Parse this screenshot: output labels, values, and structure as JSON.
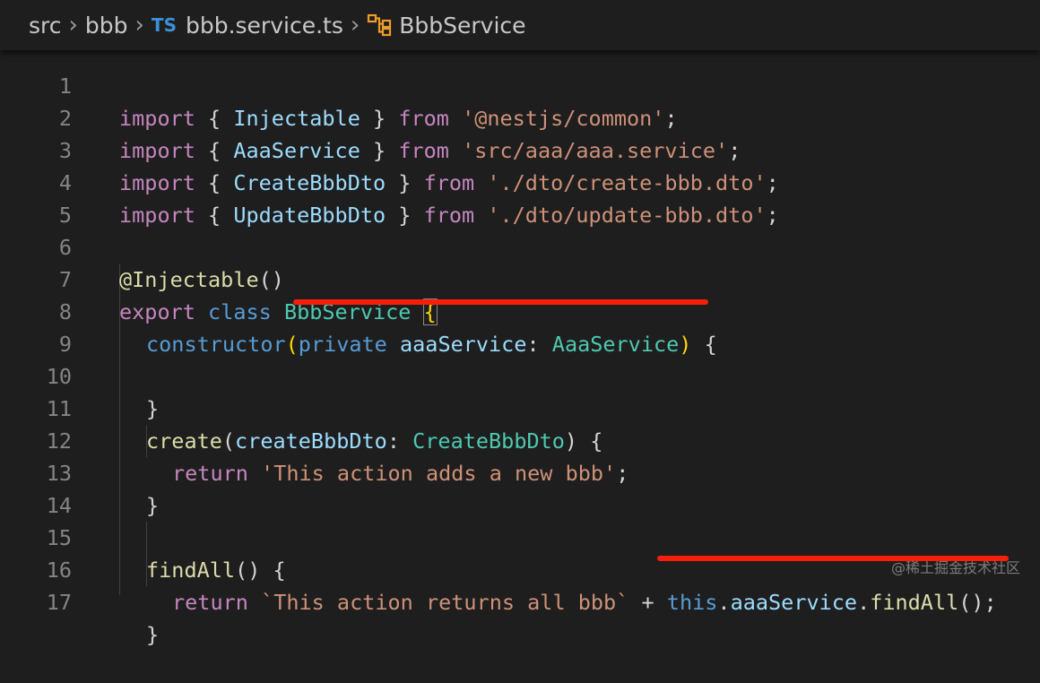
{
  "breadcrumb": {
    "folder": "src",
    "subfolder": "bbb",
    "file_badge": "TS",
    "file": "bbb.service.ts",
    "symbol": "BbbService"
  },
  "colors": {
    "background": "#1e1e1e",
    "keyword": "#c586c0",
    "string": "#ce9178",
    "type": "#4ec9b0",
    "function": "#dcdcaa",
    "storage": "#569cd6",
    "variable": "#9cdcfe",
    "highlight_underline": "#f71f0b"
  },
  "editor": {
    "lines": [
      {
        "n": "1"
      },
      {
        "n": "2"
      },
      {
        "n": "3"
      },
      {
        "n": "4"
      },
      {
        "n": "5"
      },
      {
        "n": "6"
      },
      {
        "n": "7"
      },
      {
        "n": "8"
      },
      {
        "n": "9"
      },
      {
        "n": "10"
      },
      {
        "n": "11"
      },
      {
        "n": "12"
      },
      {
        "n": "13"
      },
      {
        "n": "14"
      },
      {
        "n": "15"
      },
      {
        "n": "16"
      },
      {
        "n": "17"
      }
    ],
    "tokens": {
      "import": "import",
      "from": "from",
      "lbrace": "{",
      "rbrace": "}",
      "semi": ";",
      "injectable": "Injectable",
      "nest_common": "'@nestjs/common'",
      "aaa_service_type": "AaaService",
      "aaa_service_path": "'src/aaa/aaa.service'",
      "create_dto": "CreateBbbDto",
      "create_dto_path": "'./dto/create-bbb.dto'",
      "update_dto": "UpdateBbbDto",
      "update_dto_path": "'./dto/update-bbb.dto'",
      "decorator": "@Injectable",
      "parens": "()",
      "export": "export",
      "class": "class",
      "class_name": "BbbService",
      "constructor": "constructor",
      "lparen": "(",
      "rparen": ")",
      "private": "private",
      "aaa_service_param": "aaaService",
      "colon": ":",
      "create": "create",
      "create_param": "createBbbDto",
      "return": "return",
      "create_msg": "'This action adds a new bbb'",
      "find_all": "findAll",
      "find_all_msg": "`This action returns all bbb`",
      "plus": "+",
      "this": "this",
      "dot": ".",
      "call_parens": "()"
    }
  },
  "watermark": "@稀土掘金技术社区"
}
